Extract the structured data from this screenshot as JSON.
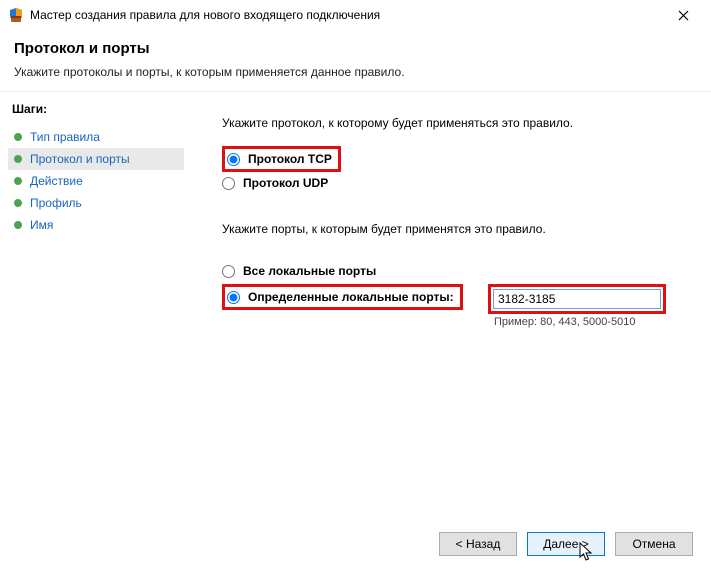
{
  "window": {
    "title": "Мастер создания правила для нового входящего подключения"
  },
  "header": {
    "title": "Протокол и порты",
    "subtitle": "Укажите протоколы и порты, к которым применяется данное правило."
  },
  "sidebar": {
    "label": "Шаги:",
    "items": [
      {
        "label": "Тип правила"
      },
      {
        "label": "Протокол и порты"
      },
      {
        "label": "Действие"
      },
      {
        "label": "Профиль"
      },
      {
        "label": "Имя"
      }
    ],
    "active_index": 1
  },
  "main": {
    "protocol_intro": "Укажите протокол, к которому будет применяться это правило.",
    "proto_tcp": "Протокол TCP",
    "proto_udp": "Протокол UDP",
    "ports_intro": "Укажите порты, к которым будет применятся это правило.",
    "ports_all": "Все локальные порты",
    "ports_specific": "Определенные локальные порты:",
    "ports_value": "3182-3185",
    "ports_example": "Пример: 80, 443, 5000-5010"
  },
  "footer": {
    "back": "< Назад",
    "next": "Далее >",
    "cancel": "Отмена"
  }
}
